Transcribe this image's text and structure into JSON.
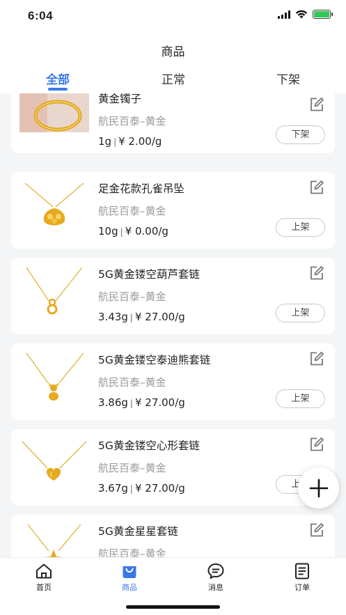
{
  "status_bar": {
    "time": "6:04"
  },
  "header": {
    "title": "商品",
    "tabs": [
      {
        "label": "全部",
        "active": true
      },
      {
        "label": "正常",
        "active": false
      },
      {
        "label": "下架",
        "active": false
      }
    ]
  },
  "products": [
    {
      "name": "黄金镯子",
      "shop": "航民百泰–黄金",
      "weight": "1g",
      "price": "¥ 2.00/g",
      "status_button": "下架",
      "image": "bracelet-photo"
    },
    {
      "name": "足金花款孔雀吊坠",
      "shop": "航民百泰–黄金",
      "weight": "10g",
      "price": "¥ 0.00/g",
      "status_button": "上架",
      "image": "peacock-pendant-photo"
    },
    {
      "name": "5G黄金镂空葫芦套链",
      "shop": "航民百泰–黄金",
      "weight": "3.43g",
      "price": "¥ 27.00/g",
      "status_button": "上架",
      "image": "gourd-necklace-photo"
    },
    {
      "name": "5G黄金镂空泰迪熊套链",
      "shop": "航民百泰–黄金",
      "weight": "3.86g",
      "price": "¥ 27.00/g",
      "status_button": "上架",
      "image": "teddy-bear-necklace-photo"
    },
    {
      "name": "5G黄金镂空心形套链",
      "shop": "航民百泰–黄金",
      "weight": "3.67g",
      "price": "¥ 27.00/g",
      "status_button": "上架",
      "image": "heart-necklace-photo"
    },
    {
      "name": "5G黄金星星套链",
      "shop": "航民百泰–黄金",
      "weight": "",
      "price": "",
      "status_button": "",
      "image": "star-necklace-photo"
    }
  ],
  "fab": {
    "icon": "plus-icon"
  },
  "bottom_nav": [
    {
      "label": "首页",
      "icon": "home-icon",
      "active": false
    },
    {
      "label": "商品",
      "icon": "shopping-bag-icon",
      "active": true
    },
    {
      "label": "消息",
      "icon": "message-icon",
      "active": false
    },
    {
      "label": "订单",
      "icon": "order-icon",
      "active": false
    }
  ],
  "colors": {
    "accent": "#3a78e8",
    "gold": "#e8b92f",
    "background": "#f4f5f7"
  }
}
